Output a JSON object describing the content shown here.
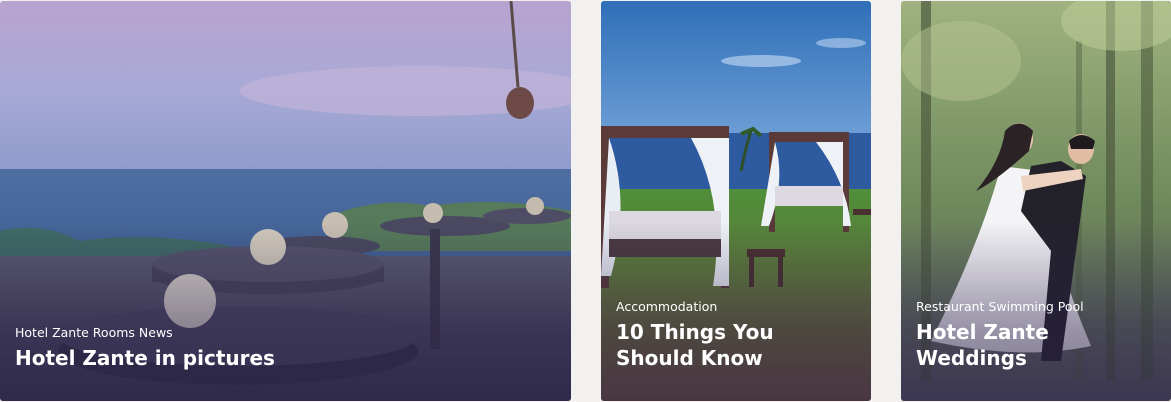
{
  "cards": [
    {
      "categories": [
        "Hotel Zante Rooms",
        "News"
      ],
      "title": "Hotel Zante in pictures"
    },
    {
      "categories": [
        "Accommodation"
      ],
      "title": "10 Things You Should Know"
    },
    {
      "categories": [
        "Restaurant",
        "Swimming Pool"
      ],
      "title": "Hotel Zante Weddings"
    }
  ]
}
